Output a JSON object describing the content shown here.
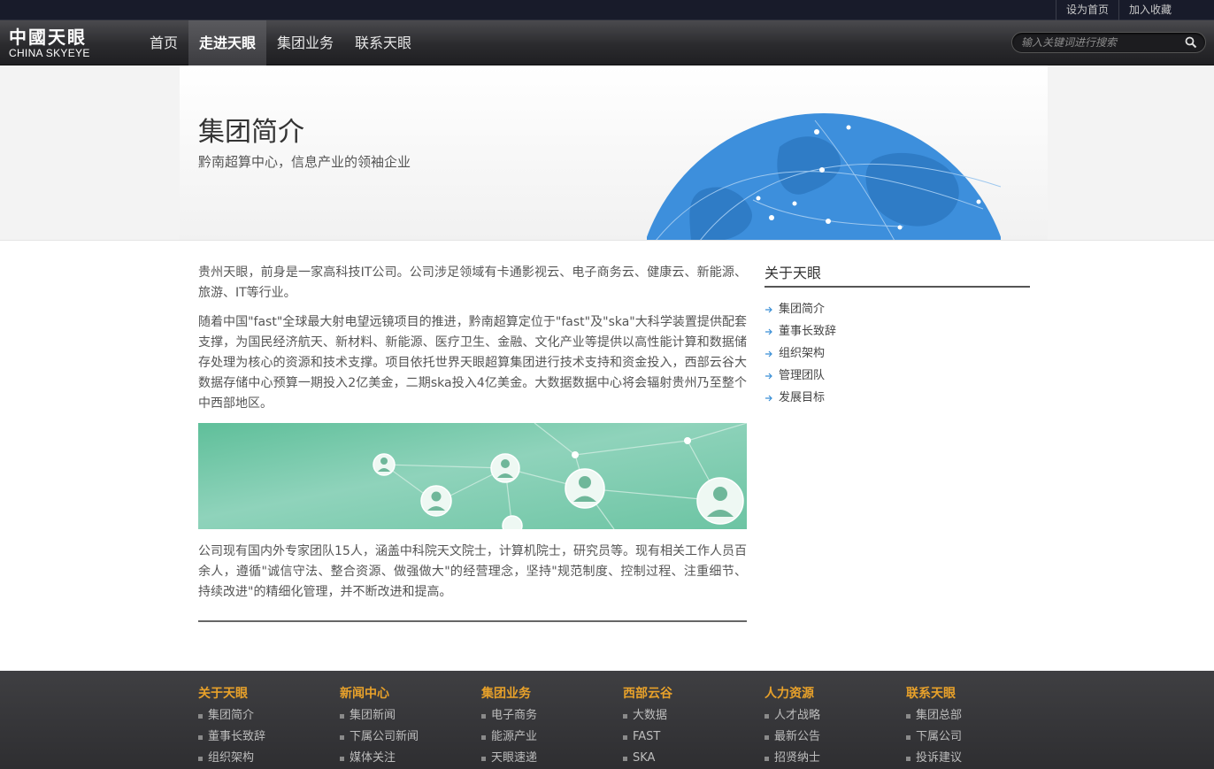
{
  "topbar": {
    "set_home": "设为首页",
    "add_favorite": "加入收藏"
  },
  "logo": {
    "cn": "中國天眼",
    "en": "CHINA SKYEYE"
  },
  "nav": [
    {
      "label": "首页"
    },
    {
      "label": "走进天眼"
    },
    {
      "label": "集团业务"
    },
    {
      "label": "联系天眼"
    }
  ],
  "search": {
    "placeholder": "输入关键词进行搜索",
    "icon": "search-icon"
  },
  "banner": {
    "title": "集团简介",
    "subtitle": "黔南超算中心，信息产业的领袖企业"
  },
  "content": {
    "p1": "贵州天眼，前身是一家高科技IT公司。公司涉足领域有卡通影视云、电子商务云、健康云、新能源、旅游、IT等行业。",
    "p2": "随着中国\"fast\"全球最大射电望远镜项目的推进，黔南超算定位于\"fast\"及\"ska\"大科学装置提供配套支撑，为国民经济航天、新材料、新能源、医疗卫生、金融、文化产业等提供以高性能计算和数据储存处理为核心的资源和技术支撑。项目依托世界天眼超算集团进行技术支持和资金投入，西部云谷大数据存储中心预算一期投入2亿美金，二期ska投入4亿美金。大数据数据中心将会辐射贵州乃至整个中西部地区。",
    "p3": "公司现有国内外专家团队15人，涵盖中科院天文院士，计算机院士，研究员等。现有相关工作人员百余人，遵循\"诚信守法、整合资源、做强做大\"的经营理念，坚持\"规范制度、控制过程、注重细节、持续改进\"的精细化管理，并不断改进和提高。"
  },
  "sidebar": {
    "title": "关于天眼",
    "items": [
      "集团简介",
      "董事长致辞",
      "组织架构",
      "管理团队",
      "发展目标"
    ]
  },
  "footer": [
    {
      "title": "关于天眼",
      "items": [
        "集团简介",
        "董事长致辞",
        "组织架构"
      ]
    },
    {
      "title": "新闻中心",
      "items": [
        "集团新闻",
        "下属公司新闻",
        "媒体关注"
      ]
    },
    {
      "title": "集团业务",
      "items": [
        "电子商务",
        "能源产业",
        "天眼速递"
      ]
    },
    {
      "title": "西部云谷",
      "items": [
        "大数据",
        "FAST",
        "SKA"
      ]
    },
    {
      "title": "人力资源",
      "items": [
        "人才战略",
        "最新公告",
        "招贤纳士"
      ]
    },
    {
      "title": "联系天眼",
      "items": [
        "集团总部",
        "下属公司",
        "投诉建议"
      ]
    }
  ],
  "colors": {
    "accent": "#e8a12a",
    "globe": "#3d8fdc",
    "network": "#6ec9a8"
  }
}
